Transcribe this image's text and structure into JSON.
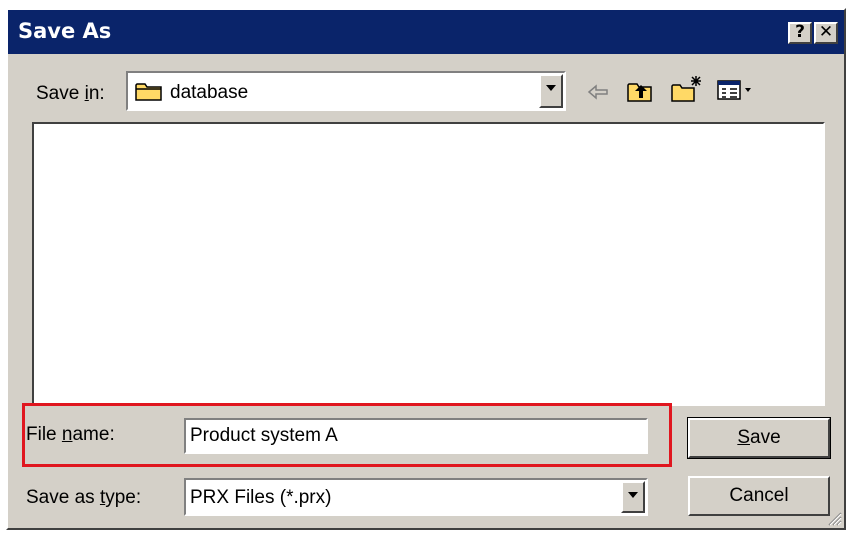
{
  "dialog": {
    "title": "Save As",
    "help_label": "?",
    "close_label": "✕"
  },
  "save_in": {
    "label_pre": "Save ",
    "label_accel": "i",
    "label_post": "n:",
    "folder": "database"
  },
  "toolbar": {
    "icons": [
      "back-arrow-icon",
      "up-one-level-icon",
      "create-new-folder-icon",
      "view-menu-icon"
    ]
  },
  "file_name": {
    "label_pre": "File ",
    "label_accel": "n",
    "label_post": "ame:",
    "value": "Product system A"
  },
  "save_as_type": {
    "label_pre": "Save as ",
    "label_accel": "t",
    "label_post": "ype:",
    "value": "PRX Files (*.prx)"
  },
  "buttons": {
    "save_accel": "S",
    "save_rest": "ave",
    "cancel": "Cancel"
  },
  "colors": {
    "title_bar": "#0a246a",
    "face": "#d4d0c8",
    "highlight_frame": "#e0161f"
  }
}
